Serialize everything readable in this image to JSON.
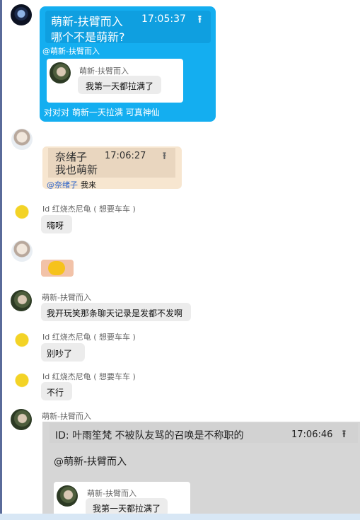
{
  "messages": {
    "m1": {
      "quote_author": "萌新-扶臂而入",
      "quote_time": "17:05:37",
      "quote_text": "哪个不是萌新?",
      "mention": "@萌新-扶臂而入",
      "inner_name": "萌新-扶臂而入",
      "inner_text": "我第一天都拉满了",
      "text": "对对对 萌新一天拉满 可真神仙"
    },
    "m2": {
      "quote_author": "奈绪子",
      "quote_time": "17:06:27",
      "quote_text": "我也萌新",
      "mention": "@奈绪子",
      "text": "我来"
    },
    "m3": {
      "name": "Id 红烧杰尼龟 ( 想要车车 )",
      "text": "嗨呀"
    },
    "m4": {
      "sticker": "yellow-duck-sticker"
    },
    "m5": {
      "name": "萌新-扶臂而入",
      "text": "我开玩笑那条聊天记录是发都不发啊"
    },
    "m6": {
      "name": "Id 红烧杰尼龟 ( 想要车车 )",
      "text": "别吵了"
    },
    "m7": {
      "name": "Id 红烧杰尼龟 ( 想要车车 )",
      "text": "不行"
    },
    "m8": {
      "name": "萌新-扶臂而入",
      "quote_line": "ID: 叶雨笙梵 不被队友骂的召唤是不称职的",
      "quote_time": "17:06:46",
      "mention": "@萌新-扶臂而入",
      "inner_name": "萌新-扶臂而入",
      "inner_text": "我第一天都拉满了"
    }
  },
  "colors": {
    "accent_blue": "#14aef0",
    "tan": "#f7e6d0",
    "bubble_grey": "#ececec"
  }
}
